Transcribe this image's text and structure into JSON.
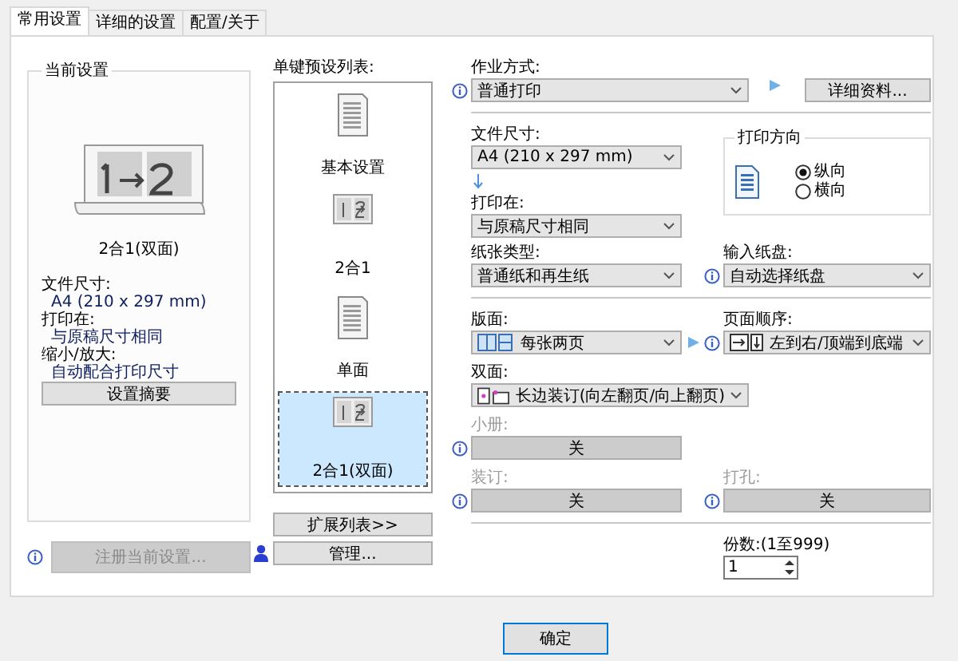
{
  "tabs": [
    {
      "label": "常用设置",
      "selected": true
    },
    {
      "label": "详细的设置",
      "selected": false
    },
    {
      "label": "配置/关于",
      "selected": false
    }
  ],
  "current_settings": {
    "title": "当前设置",
    "caption": "2合1(双面)",
    "details": [
      {
        "label": "文件尺寸:",
        "value": "A4 (210 x 297 mm)"
      },
      {
        "label": "打印在:",
        "value": "与原稿尺寸相同"
      },
      {
        "label": "缩小/放大:",
        "value": "自动配合打印尺寸"
      }
    ],
    "summary_button": "设置摘要",
    "register_button": {
      "label": "注册当前设置...",
      "disabled": true
    }
  },
  "presets": {
    "title": "单键预设列表:",
    "items": [
      {
        "label": "基本设置",
        "kind": "document",
        "selected": false
      },
      {
        "label": "2合1",
        "kind": "twoinone",
        "selected": false
      },
      {
        "label": "单面",
        "kind": "document",
        "selected": false
      },
      {
        "label": "2合1(双面)",
        "kind": "twoinone",
        "selected": true
      }
    ],
    "expand_button": "扩展列表>>",
    "manage_button": "管理..."
  },
  "job": {
    "label": "作业方式:",
    "value": "普通打印",
    "details_button": "详细资料..."
  },
  "paper_size": {
    "label": "文件尺寸:",
    "value": "A4 (210 x 297 mm)"
  },
  "print_on": {
    "label": "打印在:",
    "value": "与原稿尺寸相同"
  },
  "orientation": {
    "title": "打印方向",
    "options": [
      {
        "label": "纵向",
        "selected": true
      },
      {
        "label": "横向",
        "selected": false
      }
    ]
  },
  "paper_type": {
    "label": "纸张类型:",
    "value": "普通纸和再生纸"
  },
  "input_tray": {
    "label": "输入纸盘:",
    "value": "自动选择纸盘"
  },
  "layout": {
    "label": "版面:",
    "value": "每张两页"
  },
  "page_order": {
    "label": "页面顺序:",
    "value": "左到右/顶端到底端"
  },
  "duplex": {
    "label": "双面:",
    "value": "长边装订(向左翻页/向上翻页)"
  },
  "booklet": {
    "label": "小册:",
    "value": "关",
    "disabled": true
  },
  "binding": {
    "label": "装订:",
    "value": "关",
    "disabled": true
  },
  "punch": {
    "label": "打孔:",
    "value": "关",
    "disabled": true
  },
  "copies": {
    "label": "份数:(1至999)",
    "value": "1"
  },
  "ok_button": "确定"
}
